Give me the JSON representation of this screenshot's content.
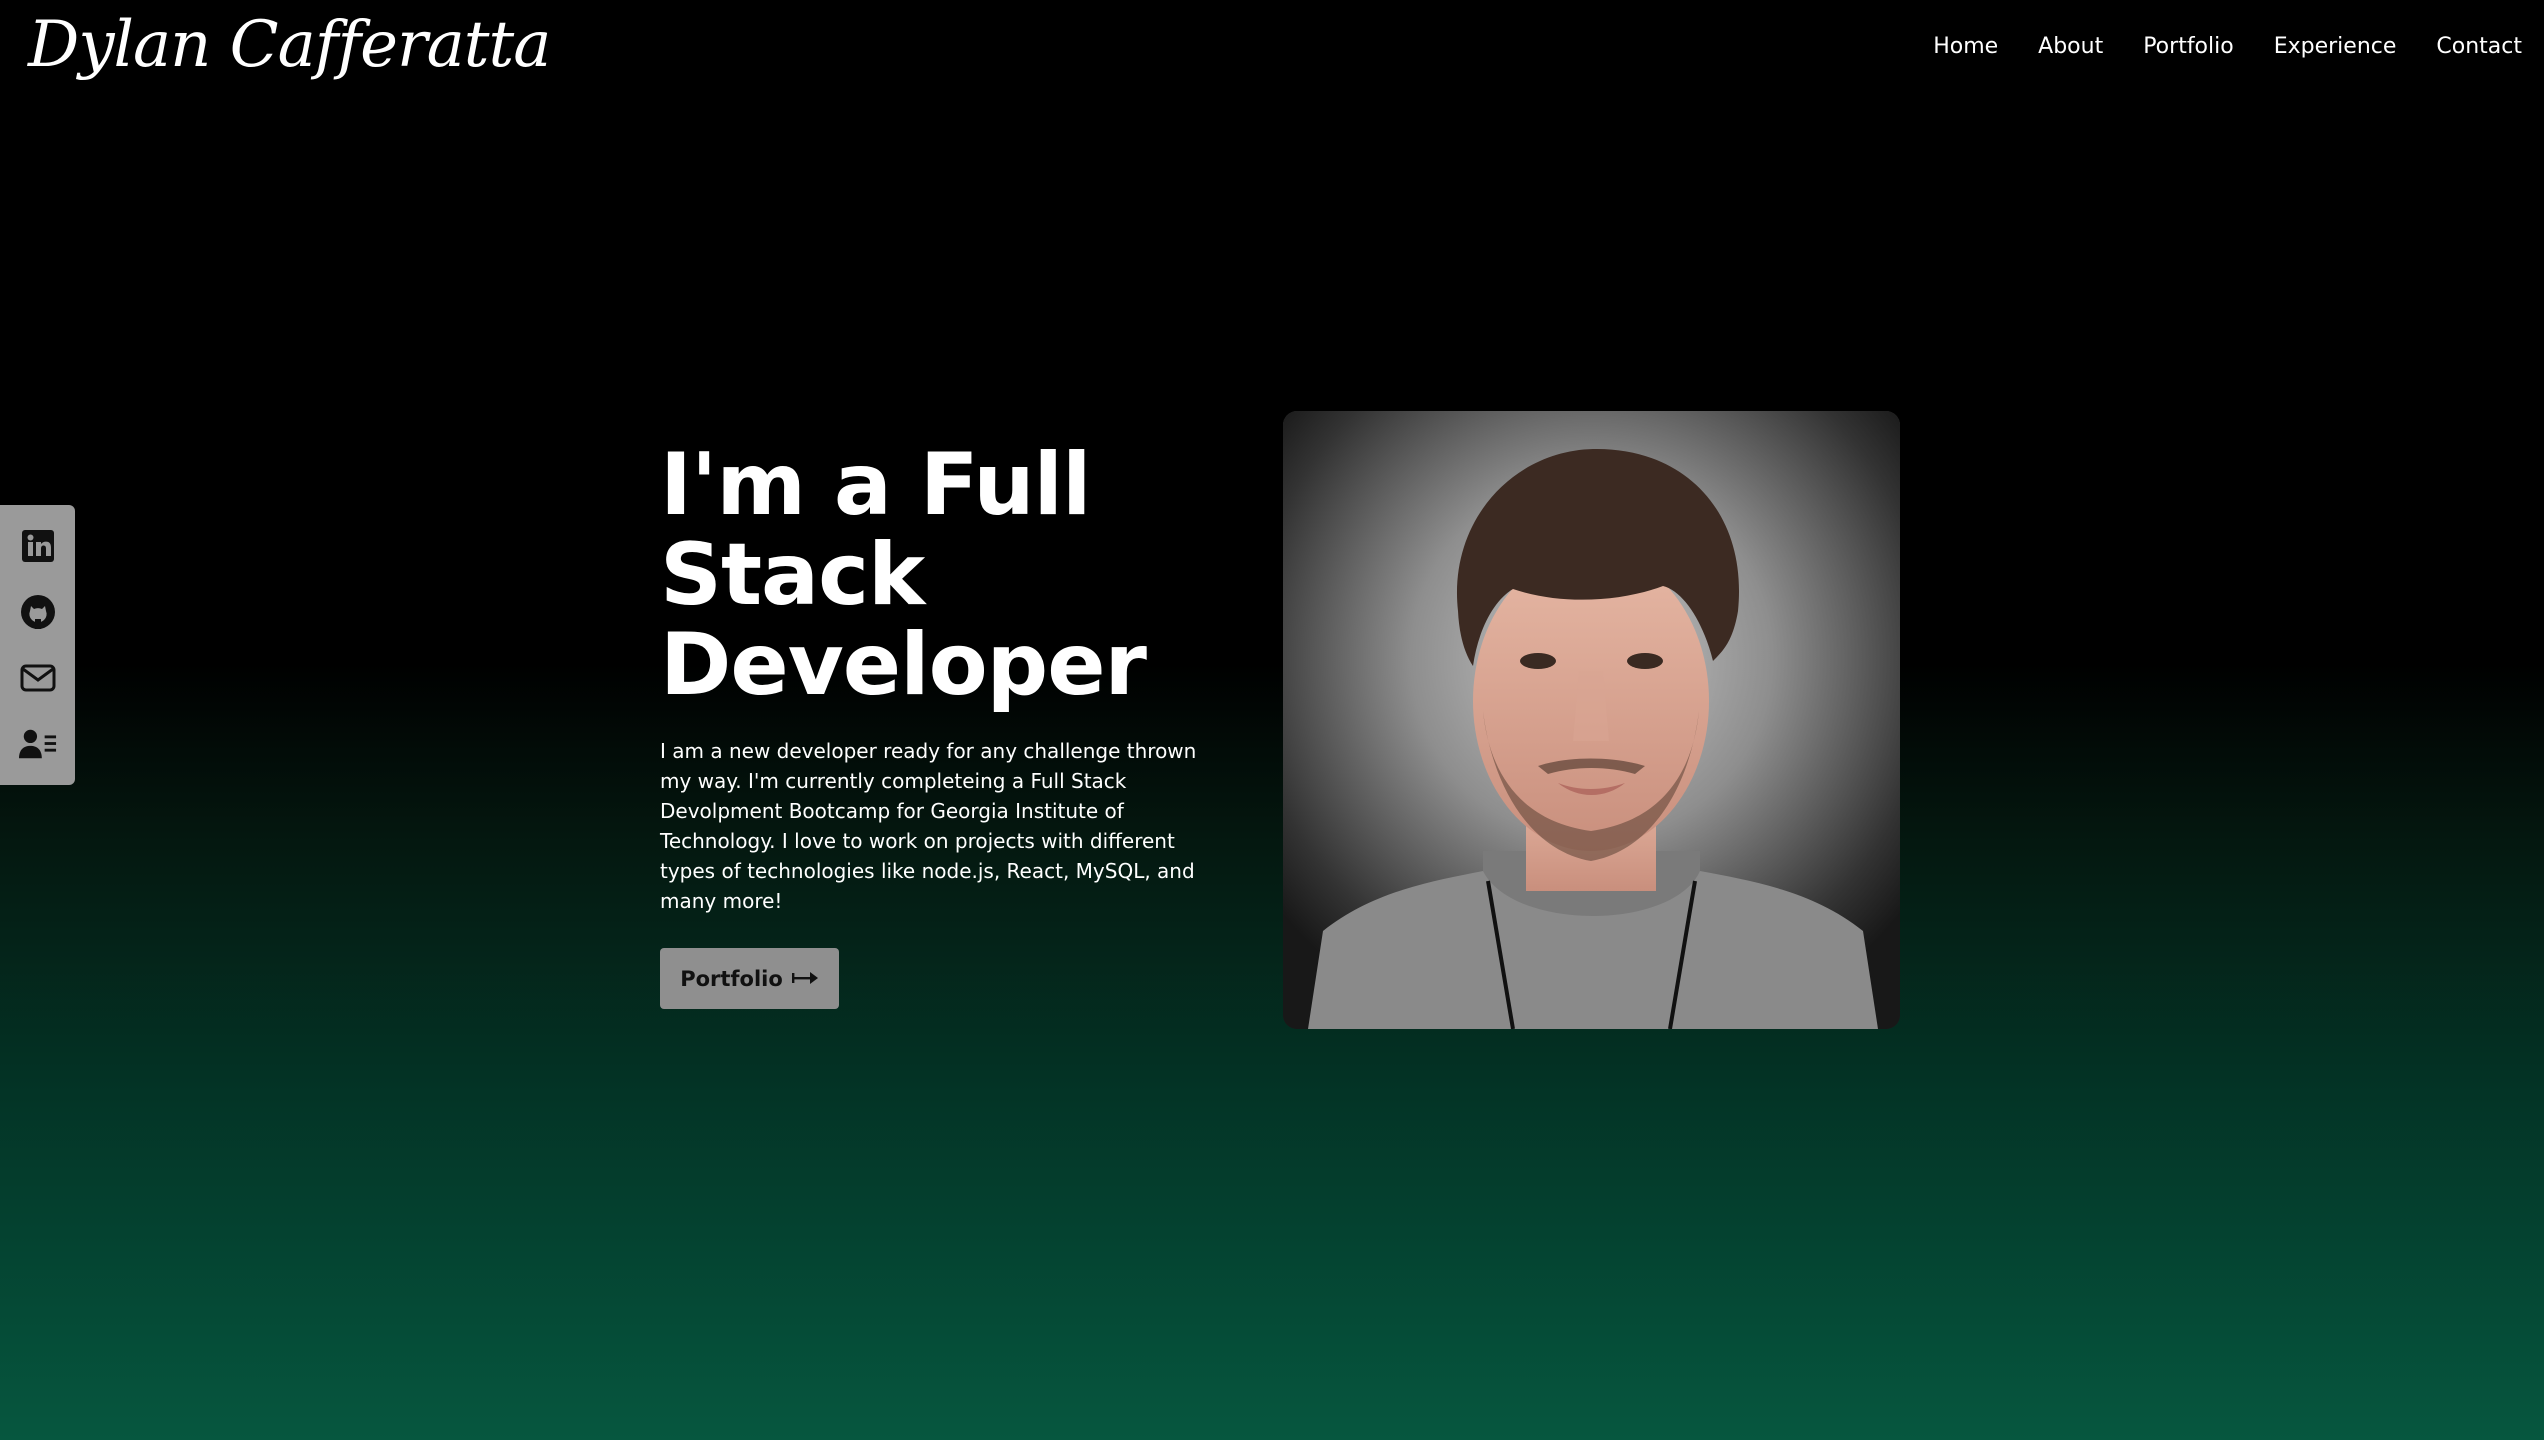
{
  "header": {
    "logo_text": "Dylan Cafferatta",
    "nav": [
      {
        "label": "Home"
      },
      {
        "label": "About"
      },
      {
        "label": "Portfolio"
      },
      {
        "label": "Experience"
      },
      {
        "label": "Contact"
      }
    ]
  },
  "social": [
    {
      "icon": "linkedin-icon"
    },
    {
      "icon": "github-icon"
    },
    {
      "icon": "mail-icon"
    },
    {
      "icon": "resume-icon"
    }
  ],
  "hero": {
    "heading": "I'm a Full Stack Developer",
    "description": "I am a new developer ready for any challenge thrown my way. I'm currently completeing a Full Stack Devolpment Bootcamp for Georgia Institute of Technology. I love to work on projects with different types of technologies like node.js, React, MySQL, and many more!",
    "button_label": "Portfolio",
    "button_icon": "long-arrow-right-icon"
  },
  "portrait": {
    "alt": "portrait-image"
  },
  "colors": {
    "background_top": "#000000",
    "background_bottom": "#06573f",
    "social_bar": "#9a9a9a",
    "button": "#8f8f8f",
    "text": "#ffffff"
  }
}
